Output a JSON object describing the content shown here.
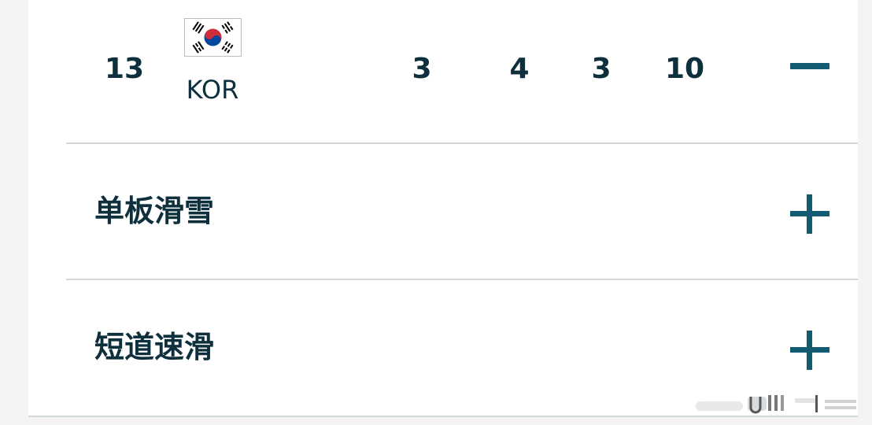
{
  "medal_row": {
    "rank": "13",
    "country_code": "KOR",
    "gold": "3",
    "silver": "4",
    "bronze": "3",
    "total": "10",
    "flag_icon": "south-korea-flag-icon",
    "toggle_icon": "minus-collapse-icon"
  },
  "sports": [
    {
      "label": "单板滑雪",
      "toggle_icon": "plus-expand-icon"
    },
    {
      "label": "短道速滑",
      "toggle_icon": "plus-expand-icon"
    }
  ],
  "colors": {
    "text": "#0e2f3c",
    "accent": "#135b73",
    "divider": "#d0d8dc",
    "flag_red": "#cd2e3a",
    "flag_blue": "#0047a0"
  }
}
